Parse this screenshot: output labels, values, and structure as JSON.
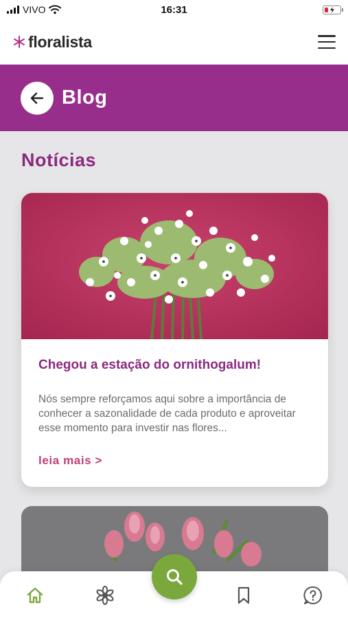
{
  "status_bar": {
    "carrier": "VIVO",
    "time": "16:31"
  },
  "header": {
    "logo_text": "floralista",
    "menu_icon": "hamburger-menu-icon"
  },
  "banner": {
    "title": "Blog",
    "back_icon": "arrow-left-icon"
  },
  "section": {
    "title": "Notícias"
  },
  "articles": [
    {
      "title": "Chegou a estação do ornithogalum!",
      "excerpt": "Nós sempre reforçamos aqui sobre a importância de conhecer a sazonalidade de cada produto e aproveitar esse momento para investir nas flores...",
      "read_more": "leia mais >",
      "image": "ornithogalum-white-flowers-photo"
    },
    {
      "image": "pink-tulips-photo"
    }
  ],
  "bottom_nav": {
    "items": [
      "home-icon",
      "flower-icon",
      "search-icon",
      "bookmark-icon",
      "help-icon"
    ],
    "active": "home-icon"
  },
  "colors": {
    "brand_purple": "#982e8c",
    "title_purple": "#8b2a80",
    "link_pink": "#c13e74",
    "accent_green": "#7ba83d",
    "background": "#e6e6e8"
  }
}
